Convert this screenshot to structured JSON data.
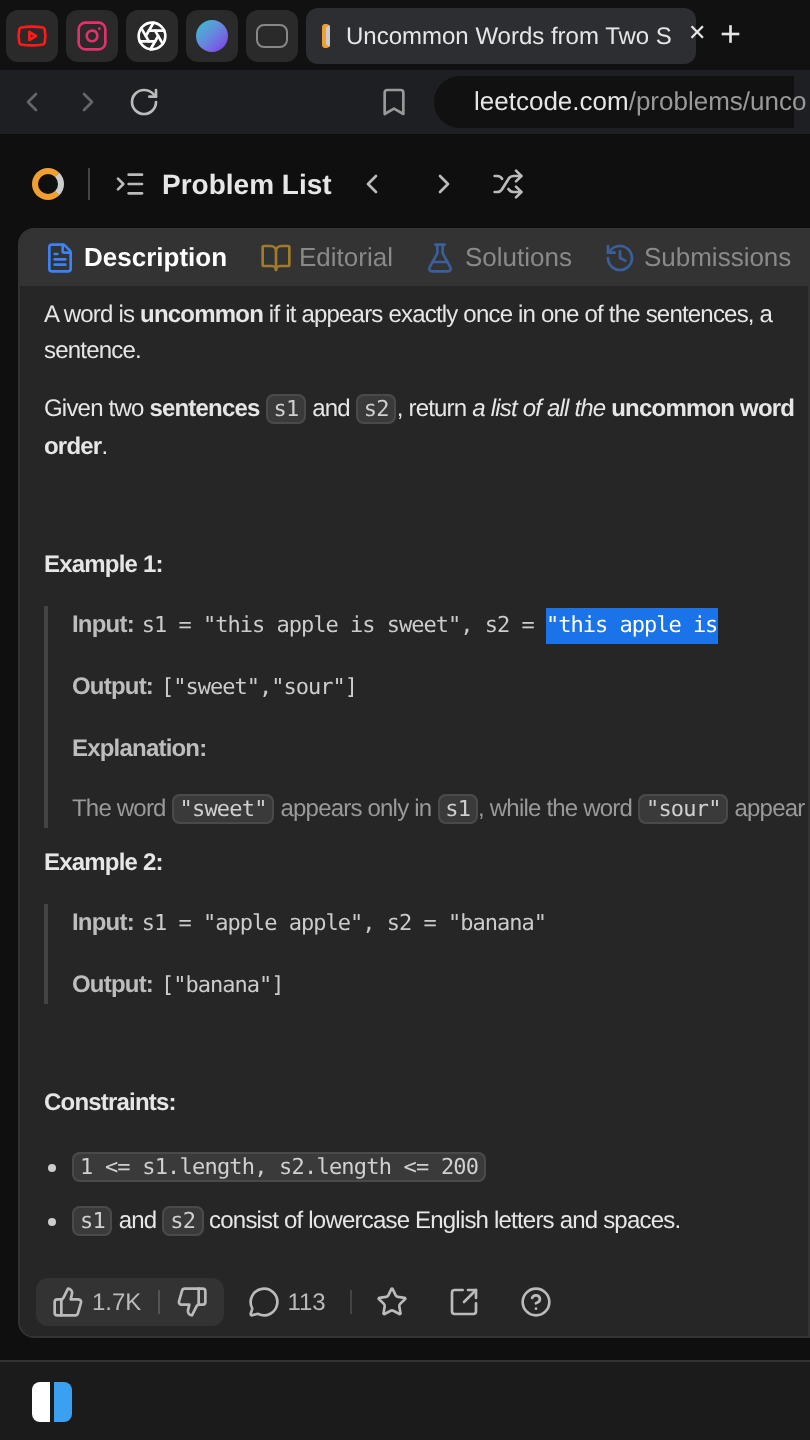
{
  "browser": {
    "pinned_tabs": [
      {
        "kind": "youtube"
      },
      {
        "kind": "instagram"
      },
      {
        "kind": "chat"
      },
      {
        "kind": "canva"
      },
      {
        "kind": "dev"
      }
    ],
    "active_tab": {
      "title": "Uncommon Words from Two S",
      "close": "✕"
    },
    "new_tab": "+",
    "address": {
      "host": "leetcode.com",
      "path": "/problems/unco"
    }
  },
  "header": {
    "title": "Problem List"
  },
  "tabs": [
    {
      "label": "Description",
      "selected": true,
      "kind": "description"
    },
    {
      "label": "Editorial",
      "selected": false,
      "kind": "editorial"
    },
    {
      "label": "Solutions",
      "selected": false,
      "kind": "solutions"
    },
    {
      "label": "Submissions",
      "selected": false,
      "kind": "submissions"
    }
  ],
  "paragraphs": [
    [
      [
        {
          "kind": "text",
          "text": "A word is **uncommon** if it appears exactly once in one of the sentences, a"
        }
      ],
      [
        {
          "kind": "text",
          "text": "sentence."
        }
      ]
    ],
    [
      [
        {
          "kind": "text",
          "text": "Given two **sentences** "
        },
        {
          "kind": "code",
          "text": "s1"
        },
        {
          "kind": "text",
          "text": " and "
        },
        {
          "kind": "code",
          "text": "s2"
        },
        {
          "kind": "text",
          "text": ", return *a list of all the* **uncommon word**"
        }
      ],
      [
        {
          "kind": "text",
          "text": "**order**."
        }
      ]
    ]
  ],
  "examples": [
    {
      "title": "Example 1:",
      "lines": [
        {
          "label": "Input:",
          "value": "s1 = \"this apple is sweet\", s2 = ",
          "selected_text": "\"this apple is"
        },
        {
          "label": "Output:",
          "value": "[\"sweet\",\"sour\"]"
        },
        {
          "label": "Explanation:"
        },
        {
          "segments": [
            {
              "kind": "text",
              "text": "The word "
            },
            {
              "kind": "code",
              "text": "\"sweet\""
            },
            {
              "kind": "text",
              "text": " appears only in "
            },
            {
              "kind": "code",
              "text": "s1"
            },
            {
              "kind": "text",
              "text": ", while the word "
            },
            {
              "kind": "code",
              "text": "\"sour\""
            },
            {
              "kind": "text",
              "text": " appear"
            }
          ]
        }
      ]
    },
    {
      "title": "Example 2:",
      "lines": [
        {
          "label": "Input:",
          "value": "s1 = \"apple apple\", s2 = \"banana\""
        },
        {
          "label": "Output:",
          "value": "[\"banana\"]"
        }
      ]
    }
  ],
  "constraints": {
    "title": "Constraints:",
    "items": [
      [
        {
          "kind": "code",
          "text": "1 <= s1.length, s2.length <= 200"
        }
      ],
      [
        {
          "kind": "code",
          "text": "s1"
        },
        {
          "kind": "text",
          "text": " and "
        },
        {
          "kind": "code",
          "text": "s2"
        },
        {
          "kind": "text",
          "text": " consist of lowercase English letters and spaces."
        }
      ]
    ]
  },
  "footer": {
    "likes": "1.7K",
    "comments": "113"
  }
}
